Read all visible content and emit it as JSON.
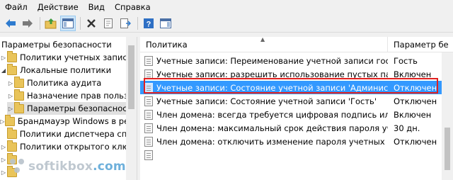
{
  "menu": {
    "items": [
      "Файл",
      "Действие",
      "Вид",
      "Справка"
    ]
  },
  "toolbar": {
    "buttons": [
      {
        "icon": "back-arrow-icon"
      },
      {
        "icon": "forward-arrow-icon"
      },
      {
        "icon": "up-folder-icon"
      },
      {
        "icon": "show-hide-tree-icon"
      },
      {
        "icon": "delete-icon"
      },
      {
        "icon": "properties-icon"
      },
      {
        "icon": "export-list-icon"
      },
      {
        "icon": "help-icon"
      },
      {
        "icon": "console-pane-icon"
      }
    ]
  },
  "tree": {
    "items": [
      {
        "label": "Параметры безопасности",
        "icon": "none",
        "indent": 0
      },
      {
        "label": "Политики учетных записей",
        "icon": "folder-icon",
        "indent": 1
      },
      {
        "label": "Локальные политики",
        "icon": "folder-icon",
        "indent": 1
      },
      {
        "label": "Политика аудита",
        "icon": "folder-icon",
        "indent": 2
      },
      {
        "label": "Назначение прав пользо",
        "icon": "folder-icon",
        "indent": 2
      },
      {
        "label": "Параметры безопасности",
        "icon": "folder-icon",
        "indent": 2,
        "selected": true
      },
      {
        "label": "Брандмауэр Windows в режи",
        "icon": "firewall-icon",
        "indent": 1
      },
      {
        "label": "Политики диспетчера списк",
        "icon": "folder-icon",
        "indent": 1
      },
      {
        "label": "Политики открытого ключа",
        "icon": "folder-icon",
        "indent": 1
      },
      {
        "label": "",
        "icon": "folder-icon",
        "indent": 1
      },
      {
        "label": "",
        "icon": "folder-icon",
        "indent": 1
      }
    ]
  },
  "table": {
    "columns": [
      "Политика",
      "Параметр бе"
    ],
    "rows": [
      {
        "policy": "Учетные записи: Переименование учетной записи гостя",
        "value": "Гость"
      },
      {
        "policy": "Учетные записи: разрешить использование пустых пароля...",
        "value": "Включен"
      },
      {
        "policy": "Учетные записи: Состояние учетной записи 'Администра...",
        "value": "Отключен",
        "selected": true
      },
      {
        "policy": "Учетные записи: Состояние учетной записи 'Гость'",
        "value": "Отключен"
      },
      {
        "policy": "Член домена: всегда требуется цифровая подпись или ш...",
        "value": "Включен"
      },
      {
        "policy": "Член домена: максимальный срок действия пароля учет...",
        "value": "30 дн."
      },
      {
        "policy": "Член домена: отключить изменение пароля учетных за...",
        "value": "Отключен"
      },
      {
        "policy": "",
        "value": ""
      }
    ]
  },
  "watermark": {
    "text": "softikbox",
    "domain": ".com"
  },
  "colors": {
    "selection": "#3399ff",
    "highlight_border": "#e02020",
    "watermark_gray": "#b9c3cc",
    "watermark_blue": "#5fa8d8"
  }
}
